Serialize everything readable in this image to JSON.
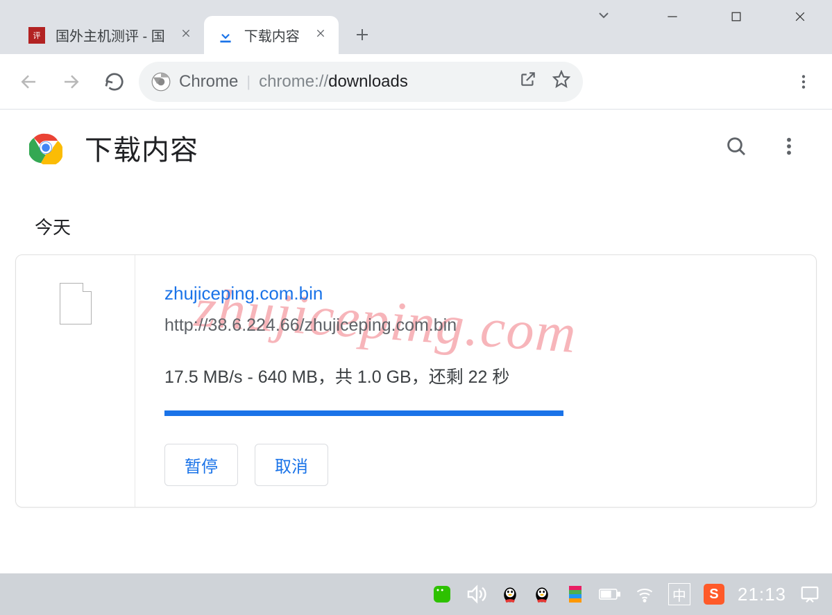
{
  "window": {
    "tabs": [
      {
        "title": "国外主机测评 - 国",
        "active": false
      },
      {
        "title": "下载内容",
        "active": true
      }
    ]
  },
  "toolbar": {
    "app_label": "Chrome",
    "url_scheme": "chrome://",
    "url_path": "downloads"
  },
  "page": {
    "title": "下载内容",
    "section_today": "今天"
  },
  "download": {
    "filename": "zhujiceping.com.bin",
    "source_url": "http://38.6.224.66/zhujiceping.com.bin",
    "status": "17.5 MB/s - 640 MB，共 1.0 GB，还剩 22 秒",
    "progress_percent": 64,
    "pause_label": "暂停",
    "cancel_label": "取消"
  },
  "watermark": "zhujiceping.com",
  "taskbar": {
    "ime": "中",
    "sogou": "S",
    "time": "21:13"
  }
}
